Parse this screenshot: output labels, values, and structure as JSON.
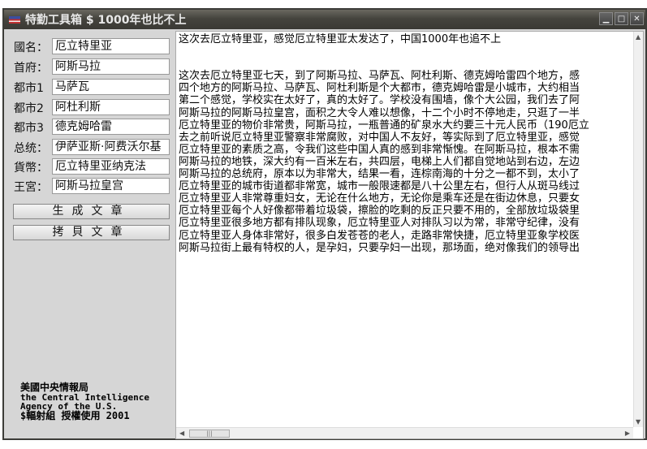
{
  "window": {
    "title": "特勤工具箱 $ 1000年也比不上"
  },
  "form": [
    {
      "label": "國名：",
      "value": "厄立特里亚"
    },
    {
      "label": "首府：",
      "value": "阿斯马拉"
    },
    {
      "label": "都市1",
      "value": "马萨瓦"
    },
    {
      "label": "都市2",
      "value": "阿杜利斯"
    },
    {
      "label": "都市3",
      "value": "德克姆哈雷"
    },
    {
      "label": "总统：",
      "value": "伊萨亚斯·阿费沃尔基"
    },
    {
      "label": "貨幣：",
      "value": "厄立特里亚纳克法"
    },
    {
      "label": "王宮：",
      "value": "阿斯马拉皇宫"
    }
  ],
  "buttons": {
    "generate": "生成文章",
    "copy": "拷貝文章"
  },
  "credits": {
    "line1": "美國中央情報局",
    "line2": "the Central Intelligence",
    "line3": "Agency of the U.S.",
    "line4": "$輻射組 授權使用  2001"
  },
  "article": {
    "text": "这次去厄立特里亚，感觉厄立特里亚太发达了，中国1000年也追不上\n\n\n这次去厄立特里亚七天，到了阿斯马拉、马萨瓦、阿杜利斯、德克姆哈雷四个地方，感\n四个地方的阿斯马拉、马萨瓦、阿杜利斯是个大都市，德克姆哈雷是小城市，大约相当\n第二个感觉，学校实在太好了，真的太好了。学校没有围墙，像个大公园，我们去了阿\n阿斯马拉的阿斯马拉皇宫，面积之大令人难以想像，十二个小时不停地走，只逛了一半\n厄立特里亚的物价非常贵，阿斯马拉，一瓶普通的矿泉水大约要三十元人民币（190厄立\n去之前听说厄立特里亚警察非常腐败，对中国人不友好，等实际到了厄立特里亚，感觉\n厄立特里亚的素质之高，令我们这些中国人真的感到非常惭愧。在阿斯马拉，根本不需\n阿斯马拉的地铁，深大约有一百米左右，共四层，电梯上人们都自觉地站到右边，左边\n阿斯马拉的总统府，原本以为非常大，结果一看，连棕南海的十分之一都不到，太小了\n厄立特里亚的城市街道都非常宽，城市一般限速都是八十公里左右，但行人从斑马线过\n厄立特里亚人非常尊重妇女，无论在什么地方，无论你是乘车还是在街边休息，只要女\n厄立特里亚每个人好像都带着垃圾袋，擦脸的吃剩的反正只要不用的，全部放垃圾袋里\n厄立特里亚很多地方都有排队现象，厄立特里亚人对排队习以为常，非常守纪律，没有\n厄立特里亚人身体非常好，很多白发苍苍的老人，走路非常快捷，厄立特里亚象学校医\n阿斯马拉街上最有特权的人，是孕妇，只要孕妇一出现，那场面，绝对像我们的领导出"
  }
}
